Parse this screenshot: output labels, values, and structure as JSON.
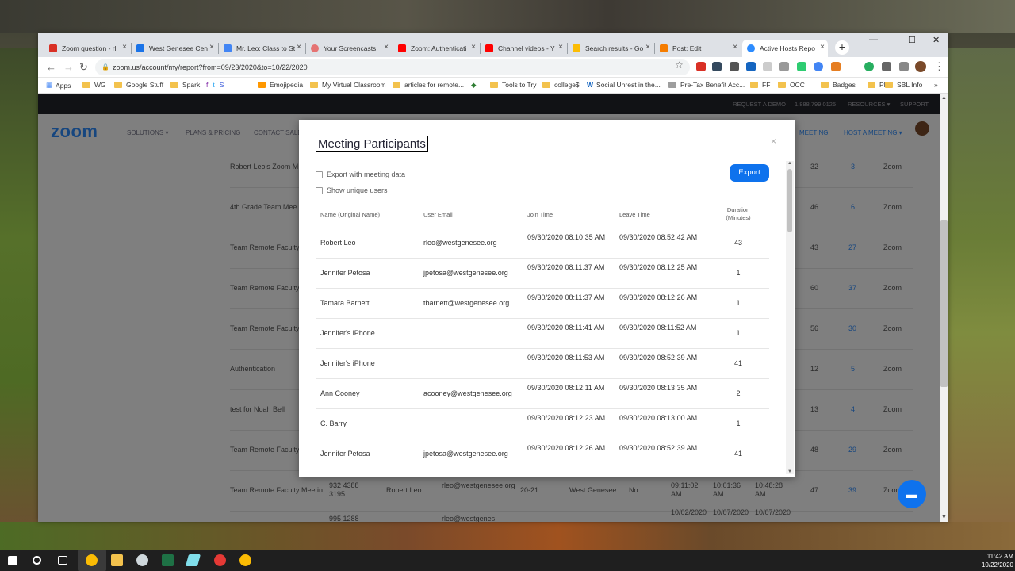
{
  "browser": {
    "tabs": [
      {
        "label": "Zoom question - rl",
        "color": "#d93025"
      },
      {
        "label": "West Genesee Cen",
        "color": "#1a73e8"
      },
      {
        "label": "Mr. Leo: Class to St",
        "color": "#4285f4"
      },
      {
        "label": "Your Screencasts",
        "color": "#e57373"
      },
      {
        "label": "Zoom: Authenticati",
        "color": "#ff0000"
      },
      {
        "label": "Channel videos - Y",
        "color": "#ff0000"
      },
      {
        "label": "Search results - Go",
        "color": "#fbbc04"
      },
      {
        "label": "Post: Edit",
        "color": "#f57c00"
      },
      {
        "label": "Active Hosts Repo",
        "color": "#2d8cff"
      }
    ],
    "url": "zoom.us/account/my/report?from=09/23/2020&to=10/22/2020",
    "bookmarks": [
      "Apps",
      "WG",
      "Google Stuff",
      "Spark",
      "Emojipedia",
      "My Virtual Classroom",
      "articles for remote...",
      "Tools to Try",
      "college$",
      "Social Unrest in the...",
      "Pre-Tax Benefit Acc...",
      "FF",
      "OCC",
      "Badges",
      "PD",
      "SBL Info"
    ]
  },
  "zoom": {
    "topbar": {
      "request_demo": "REQUEST A DEMO",
      "phone": "1.888.799.0125",
      "resources": "RESOURCES ▾",
      "support": "SUPPORT"
    },
    "logo": "zoom",
    "nav": {
      "solutions": "SOLUTIONS ▾",
      "plans": "PLANS & PRICING",
      "contact": "CONTACT SALES",
      "meeting": "MEETING",
      "host": "HOST A MEETING ▾"
    },
    "bg_rows": [
      {
        "topic": "Robert Leo's Zoom M",
        "p": "32",
        "d": "3",
        "t": "Zoom"
      },
      {
        "topic": "4th Grade Team Mee",
        "p": "46",
        "d": "6",
        "t": "Zoom"
      },
      {
        "topic": "Team Remote Faculty",
        "p": "43",
        "d": "27",
        "t": "Zoom"
      },
      {
        "topic": "Team Remote Faculty",
        "p": "60",
        "d": "37",
        "t": "Zoom"
      },
      {
        "topic": "Team Remote Faculty",
        "p": "56",
        "d": "30",
        "t": "Zoom"
      },
      {
        "topic": "Authentication",
        "p": "12",
        "d": "5",
        "t": "Zoom"
      },
      {
        "topic": "test for Noah Bell",
        "p": "13",
        "d": "4",
        "t": "Zoom"
      },
      {
        "topic": "Team Remote Faculty",
        "p": "48",
        "d": "29",
        "t": "Zoom"
      },
      {
        "topic": "Team Remote Faculty Meetin...",
        "p": "47",
        "d": "39",
        "t": "Zoom"
      }
    ],
    "bg_partial": {
      "id": "932 4388 3195",
      "user": "Robert Leo",
      "email": "rleo@westgenesee.org",
      "dept": "20-21",
      "group": "West Genesee",
      "pw": "No",
      "start": "09:11:02 AM",
      "end1": "10:01:36 AM",
      "end2": "10:48:28 AM",
      "id2": "995 1288",
      "email2": "rleo@westgenes",
      "d1": "10/02/2020",
      "d2": "10/07/2020",
      "d3": "10/07/2020"
    }
  },
  "modal": {
    "title": "Meeting Participants",
    "close": "×",
    "export_with_data": "Export with meeting data",
    "show_unique": "Show unique users",
    "export_button": "Export",
    "headers": {
      "name": "Name (Original Name)",
      "email": "User Email",
      "join": "Join Time",
      "leave": "Leave Time",
      "duration": "Duration (Minutes)"
    },
    "rows": [
      {
        "name": "Robert Leo",
        "email": "rleo@westgenesee.org",
        "join": "09/30/2020 08:10:35 AM",
        "leave": "09/30/2020 08:52:42 AM",
        "duration": "43"
      },
      {
        "name": "Jennifer Petosa",
        "email": "jpetosa@westgenesee.org",
        "join": "09/30/2020 08:11:37 AM",
        "leave": "09/30/2020 08:12:25 AM",
        "duration": "1"
      },
      {
        "name": "Tamara Barnett",
        "email": "tbarnett@westgenesee.org",
        "join": "09/30/2020 08:11:37 AM",
        "leave": "09/30/2020 08:12:26 AM",
        "duration": "1"
      },
      {
        "name": "Jennifer's iPhone",
        "email": "",
        "join": "09/30/2020 08:11:41 AM",
        "leave": "09/30/2020 08:11:52 AM",
        "duration": "1"
      },
      {
        "name": "Jennifer's iPhone",
        "email": "",
        "join": "09/30/2020 08:11:53 AM",
        "leave": "09/30/2020 08:52:39 AM",
        "duration": "41"
      },
      {
        "name": "Ann Cooney",
        "email": "acooney@westgenesee.org",
        "join": "09/30/2020 08:12:11 AM",
        "leave": "09/30/2020 08:13:35 AM",
        "duration": "2"
      },
      {
        "name": "C. Barry",
        "email": "",
        "join": "09/30/2020 08:12:23 AM",
        "leave": "09/30/2020 08:13:00 AM",
        "duration": "1"
      },
      {
        "name": "Jennifer Petosa",
        "email": "jpetosa@westgenesee.org",
        "join": "09/30/2020 08:12:26 AM",
        "leave": "09/30/2020 08:52:39 AM",
        "duration": "41"
      }
    ]
  },
  "taskbar": {
    "time": "11:42 AM",
    "date": "10/22/2020"
  }
}
